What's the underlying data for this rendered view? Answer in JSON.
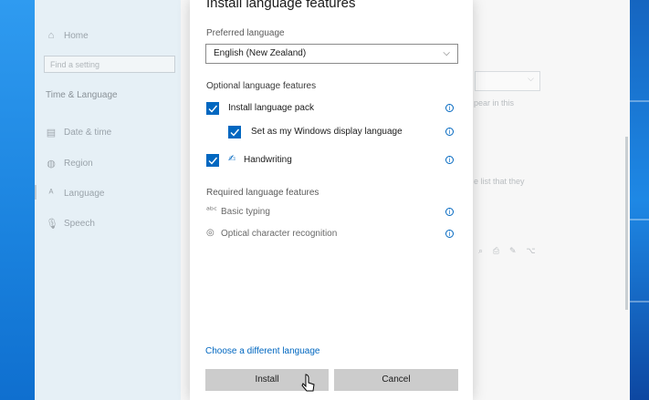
{
  "sidebar": {
    "home": "Home",
    "find_placeholder": "Find a setting",
    "section": "Time & Language",
    "items": [
      {
        "label": "Date & time",
        "icon": "calendar-clock-icon"
      },
      {
        "label": "Region",
        "icon": "globe-icon"
      },
      {
        "label": "Language",
        "icon": "language-icon"
      },
      {
        "label": "Speech",
        "icon": "microphone-icon"
      }
    ]
  },
  "background_text": {
    "fragment1": "pear in this",
    "fragment2": "e list that they"
  },
  "dialog": {
    "title": "Install language features",
    "preferred_label": "Preferred language",
    "preferred_value": "English (New Zealand)",
    "optional_label": "Optional language features",
    "optional": [
      {
        "label": "Install language pack",
        "checked": true
      },
      {
        "label": "Set as my Windows display language",
        "checked": true
      },
      {
        "label": "Handwriting",
        "checked": true
      }
    ],
    "required_label": "Required language features",
    "required": [
      {
        "label": "Basic typing",
        "icon": "keyboard-typing-icon"
      },
      {
        "label": "Optical character recognition",
        "icon": "ocr-icon"
      }
    ],
    "choose_link": "Choose a different language",
    "install_button": "Install",
    "cancel_button": "Cancel"
  },
  "colors": {
    "accent": "#0067c0",
    "button": "#cccccc"
  }
}
